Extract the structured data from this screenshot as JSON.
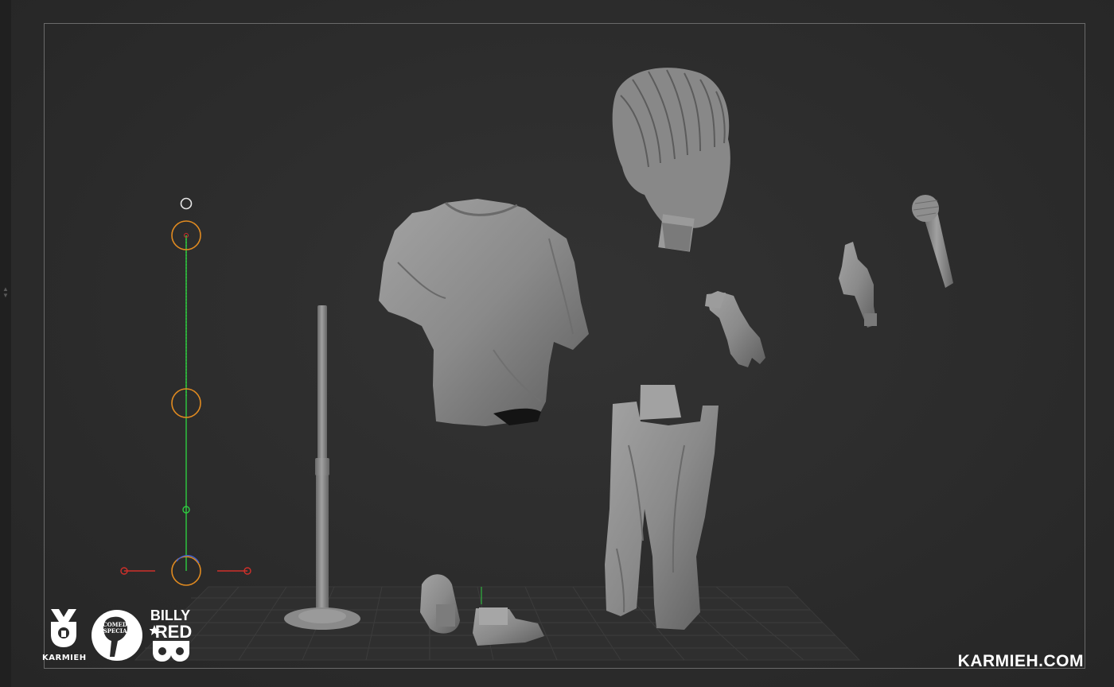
{
  "brand": {
    "studio_name": "KARMIEH",
    "website": "KARMIEH.COM",
    "logos": [
      {
        "name": "karmieh-logo",
        "text": "KARMIEH"
      },
      {
        "name": "comedy-special-logo",
        "text": "COMEDY SPECIAL"
      },
      {
        "name": "billy-red-logo",
        "text": "BILLY RED"
      }
    ]
  },
  "viewport": {
    "background": "#2b2b2b",
    "frame_color": "#6a6a6a",
    "model_color": "#8c8c8c"
  },
  "gizmo": {
    "axis_y_color": "#2ecc40",
    "axis_x_color": "#d0302a",
    "ring_color": "#e08a20",
    "top_handle_color": "#e6e6e6"
  },
  "scene_parts": [
    "head",
    "shirt-torso",
    "pants",
    "left-hand",
    "right-hand",
    "microphone",
    "microphone-stand",
    "left-shoe",
    "right-shoe"
  ]
}
